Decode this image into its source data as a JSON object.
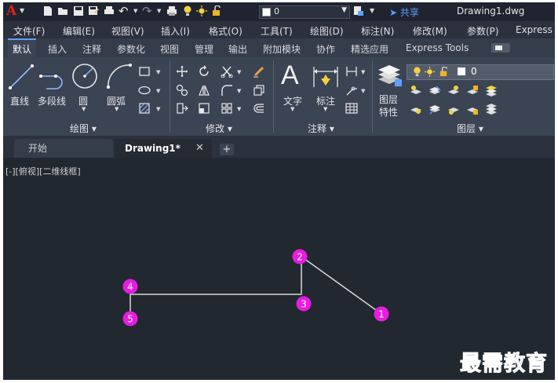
{
  "app": {
    "logo": "A",
    "document_title": "Drawing1.dwg",
    "share_label": "共享",
    "layer_value": "0"
  },
  "menu": [
    "文件(F)",
    "编辑(E)",
    "视图(V)",
    "插入(I)",
    "格式(O)",
    "工具(T)",
    "绘图(D)",
    "标注(N)",
    "修改(M)",
    "参数(P)",
    "Express"
  ],
  "ribbon_tabs": [
    "默认",
    "插入",
    "注释",
    "参数化",
    "视图",
    "管理",
    "输出",
    "附加模块",
    "协作",
    "精选应用",
    "Express Tools"
  ],
  "ribbon": {
    "draw": {
      "line": "直线",
      "polyline": "多段线",
      "circle": "圆",
      "arc": "圆弧",
      "panel": "绘图 ▾"
    },
    "modify": {
      "panel": "修改 ▾"
    },
    "annotation": {
      "text": "文字",
      "dim": "标注",
      "panel": "注释 ▾"
    },
    "layers": {
      "props_1": "图层",
      "props_2": "特性",
      "panel": "图层 ▾",
      "layer_value": "0"
    }
  },
  "file_tabs": {
    "start": "开始",
    "drawing": "Drawing1*",
    "close": "✕",
    "new": "+"
  },
  "viewport_label": "[-][俯视][二维线框]",
  "points": [
    "1",
    "2",
    "3",
    "4",
    "5"
  ],
  "watermark": "最需教育",
  "colors": {
    "marker": "#e81ce0",
    "line": "#d9d9d9",
    "canvas": "#212830"
  }
}
